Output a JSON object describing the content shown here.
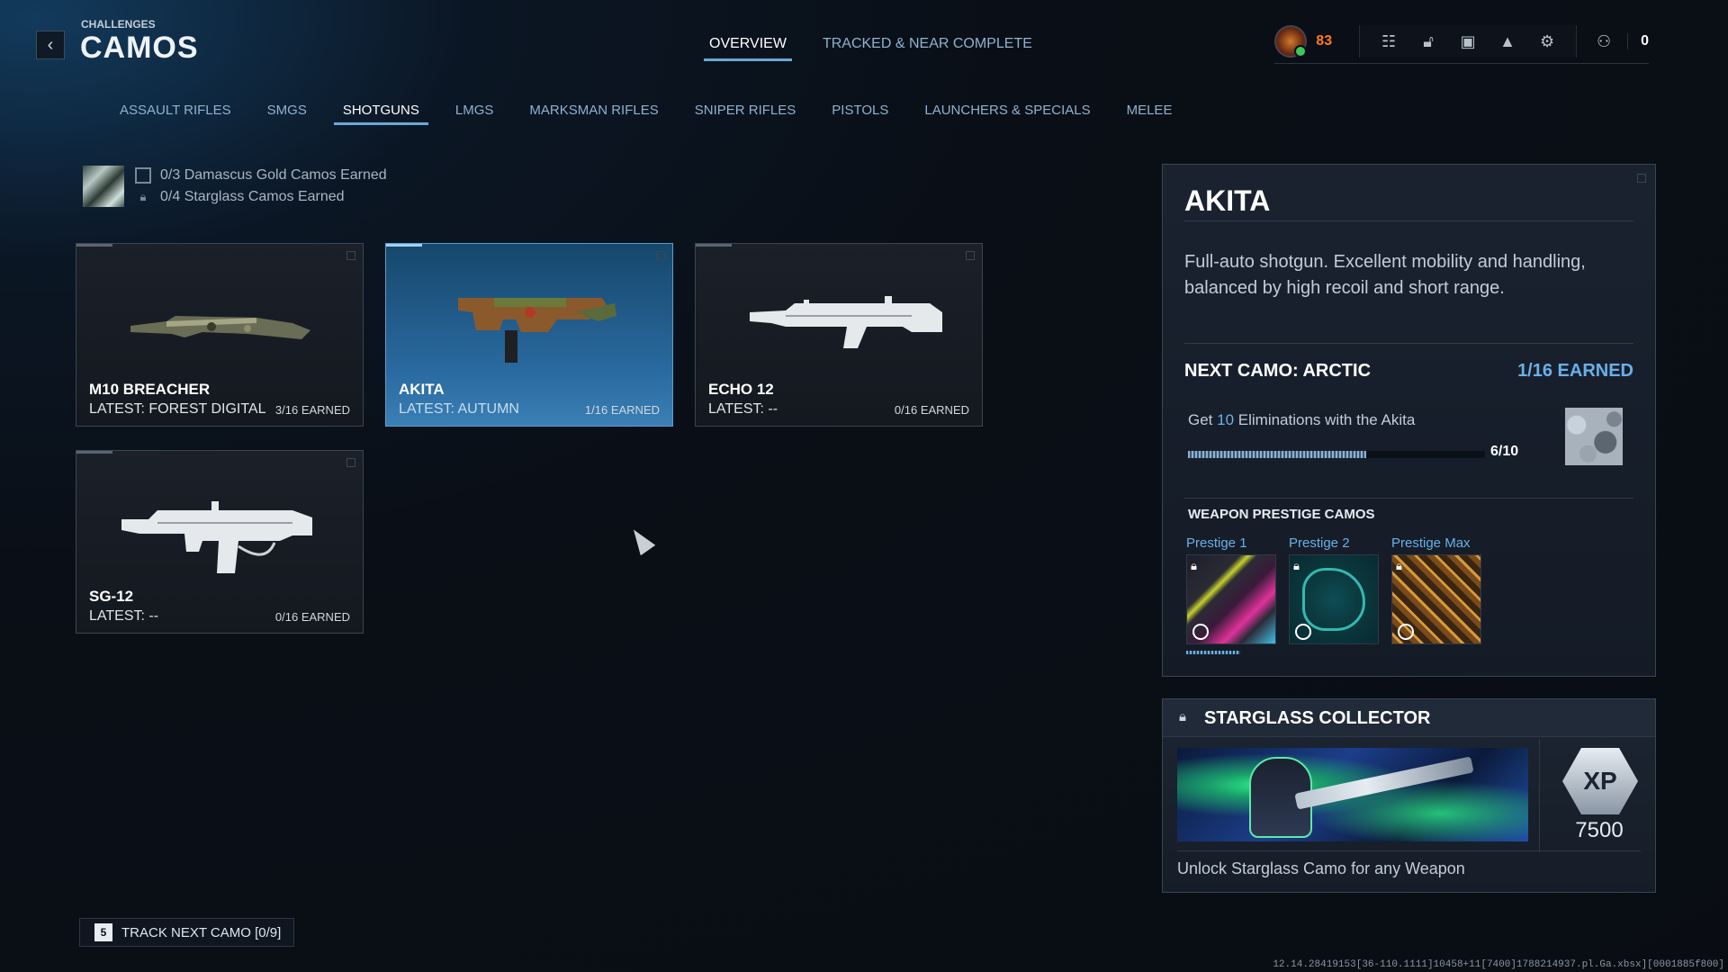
{
  "header": {
    "breadcrumb": "CHALLENGES",
    "title": "CAMOS",
    "back_icon": "chevron-left-icon"
  },
  "top_tabs": [
    {
      "label": "OVERVIEW",
      "active": true
    },
    {
      "label": "TRACKED & NEAR COMPLETE",
      "active": false
    }
  ],
  "status": {
    "level": "83",
    "level_color": "#ff7a1a",
    "icons": [
      "grid-icon",
      "unlock-icon",
      "camera-icon",
      "bell-icon",
      "gear-icon"
    ],
    "party_icon": "party-icon",
    "party_count": "0"
  },
  "category_tabs": [
    {
      "label": "ASSAULT RIFLES",
      "active": false
    },
    {
      "label": "SMGS",
      "active": false
    },
    {
      "label": "SHOTGUNS",
      "active": true
    },
    {
      "label": "LMGS",
      "active": false
    },
    {
      "label": "MARKSMAN RIFLES",
      "active": false
    },
    {
      "label": "SNIPER RIFLES",
      "active": false
    },
    {
      "label": "PISTOLS",
      "active": false
    },
    {
      "label": "LAUNCHERS & SPECIALS",
      "active": false
    },
    {
      "label": "MELEE",
      "active": false
    }
  ],
  "summary": {
    "gold": "0/3 Damascus Gold Camos Earned",
    "starglass": "0/4 Starglass Camos Earned"
  },
  "weapons": [
    {
      "name": "M10 BREACHER",
      "latest": "LATEST: FOREST DIGITAL",
      "earned": "3/16 EARNED"
    },
    {
      "name": "AKITA",
      "latest": "LATEST: AUTUMN",
      "earned": "1/16 EARNED"
    },
    {
      "name": "ECHO 12",
      "latest": "LATEST: --",
      "earned": "0/16 EARNED"
    },
    {
      "name": "SG-12",
      "latest": "LATEST: --",
      "earned": "0/16 EARNED"
    }
  ],
  "detail": {
    "title": "AKITA",
    "description": "Full-auto shotgun. Excellent mobility and handling, balanced by high recoil and short range.",
    "next_camo": "NEXT CAMO: ARCTIC",
    "next_earned": "1/16 EARNED",
    "challenge_prefix": "Get ",
    "challenge_count": "10",
    "challenge_suffix": " Eliminations with the Akita",
    "progress_text": "6/10",
    "progress_fraction": 0.6,
    "prestige_title": "WEAPON PRESTIGE CAMOS",
    "prestige": [
      {
        "label": "Prestige 1"
      },
      {
        "label": "Prestige 2"
      },
      {
        "label": "Prestige Max"
      }
    ]
  },
  "reward": {
    "title": "STARGLASS COLLECTOR",
    "xp_label": "XP",
    "xp_value": "7500",
    "description": "Unlock Starglass Camo for any Weapon"
  },
  "footer": {
    "key": "5",
    "track_label": "TRACK NEXT CAMO [0/9]",
    "build": "12.14.28419153[36-110.1111]10458+11[7400]1788214937.pl.Ga.xbsx][0001885f800]"
  }
}
